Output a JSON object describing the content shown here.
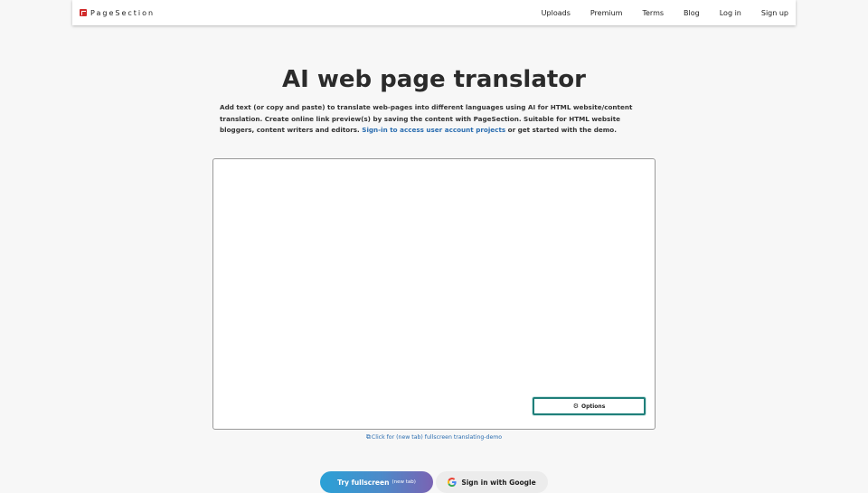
{
  "brand": {
    "name": "PageSection"
  },
  "nav": {
    "links": [
      "Uploads",
      "Premium",
      "Terms",
      "Blog",
      "Log in",
      "Sign up"
    ]
  },
  "main": {
    "title": "AI web page translator",
    "intro_text": "Add text (or copy and paste) to translate web-pages into different languages using AI for HTML website/content translation. Create online link preview(s) by saving the content with PageSection. Suitable for HTML website bloggers, content writers and editors. ",
    "intro_link": "Sign-in to access user account projects",
    "intro_tail": " or get started with the demo."
  },
  "editor": {
    "options_label": "Options",
    "options_icon": "gear-icon"
  },
  "fullscreen_link": "Click for (new tab) fullscreen translating-demo",
  "buttons": {
    "try_label": "Try fullscreen",
    "try_sub": "(new tab)",
    "google_label": "Sign in with Google"
  },
  "colors": {
    "accent_link": "#2a6db0",
    "brand_red": "#d12c2c",
    "options_border": "#1f7f7a"
  }
}
